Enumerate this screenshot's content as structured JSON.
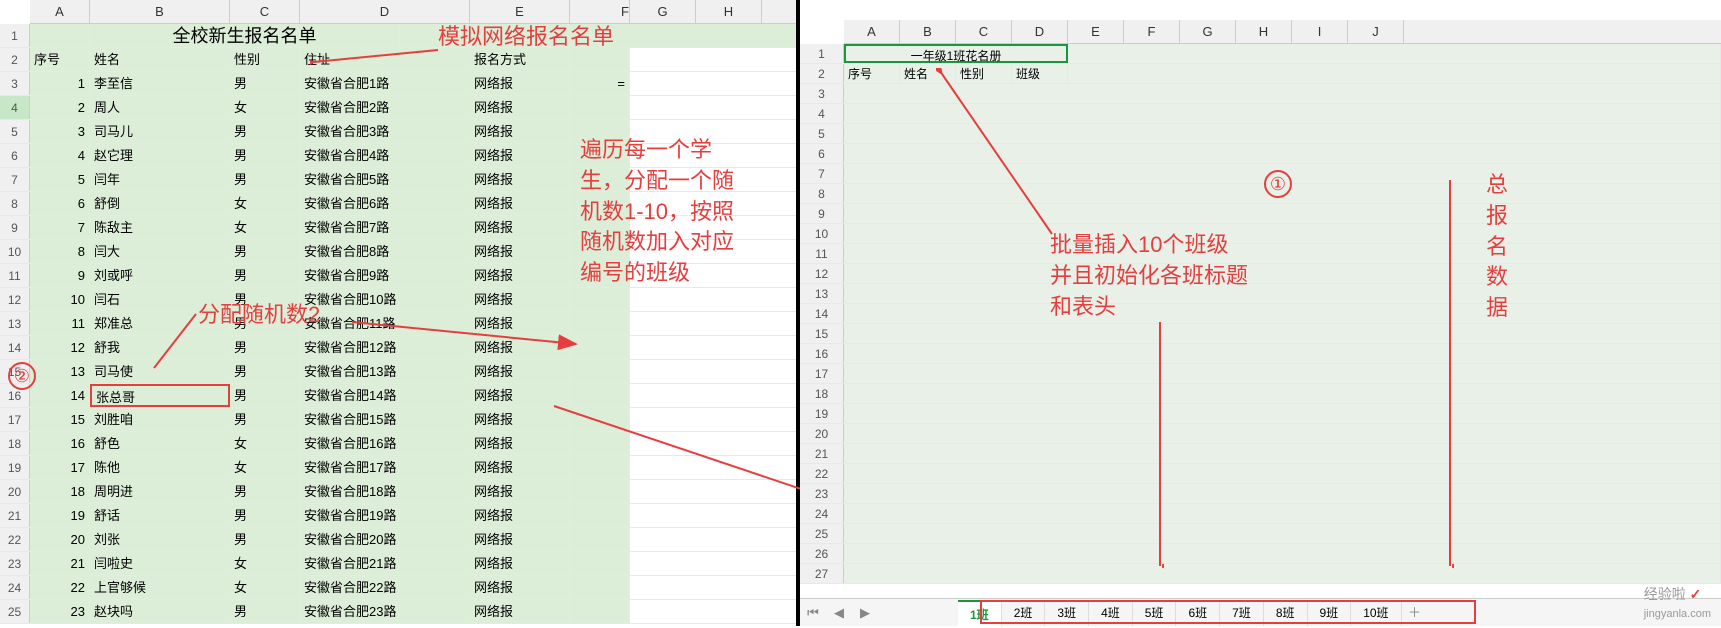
{
  "left": {
    "title": "全校新生报名名单",
    "cols": [
      "A",
      "B",
      "C",
      "D",
      "E",
      "F",
      "G",
      "H"
    ],
    "headers": [
      "序号",
      "姓名",
      "性别",
      "住址",
      "报名方式"
    ],
    "rows": [
      {
        "n": 1,
        "name": "李至信",
        "sex": "男",
        "addr": "安徽省合肥1路",
        "way": "网络报"
      },
      {
        "n": 2,
        "name": "周人",
        "sex": "女",
        "addr": "安徽省合肥2路",
        "way": "网络报"
      },
      {
        "n": 3,
        "name": "司马儿",
        "sex": "男",
        "addr": "安徽省合肥3路",
        "way": "网络报"
      },
      {
        "n": 4,
        "name": "赵它理",
        "sex": "男",
        "addr": "安徽省合肥4路",
        "way": "网络报"
      },
      {
        "n": 5,
        "name": "闫年",
        "sex": "男",
        "addr": "安徽省合肥5路",
        "way": "网络报"
      },
      {
        "n": 6,
        "name": "舒倒",
        "sex": "女",
        "addr": "安徽省合肥6路",
        "way": "网络报"
      },
      {
        "n": 7,
        "name": "陈敌主",
        "sex": "女",
        "addr": "安徽省合肥7路",
        "way": "网络报"
      },
      {
        "n": 8,
        "name": "闫大",
        "sex": "男",
        "addr": "安徽省合肥8路",
        "way": "网络报"
      },
      {
        "n": 9,
        "name": "刘或呼",
        "sex": "男",
        "addr": "安徽省合肥9路",
        "way": "网络报"
      },
      {
        "n": 10,
        "name": "闫石",
        "sex": "男",
        "addr": "安徽省合肥10路",
        "way": "网络报"
      },
      {
        "n": 11,
        "name": "郑准总",
        "sex": "男",
        "addr": "安徽省合肥11路",
        "way": "网络报"
      },
      {
        "n": 12,
        "name": "舒我",
        "sex": "男",
        "addr": "安徽省合肥12路",
        "way": "网络报"
      },
      {
        "n": 13,
        "name": "司马使",
        "sex": "男",
        "addr": "安徽省合肥13路",
        "way": "网络报"
      },
      {
        "n": 14,
        "name": "张总哥",
        "sex": "男",
        "addr": "安徽省合肥14路",
        "way": "网络报"
      },
      {
        "n": 15,
        "name": "刘胜咱",
        "sex": "男",
        "addr": "安徽省合肥15路",
        "way": "网络报"
      },
      {
        "n": 16,
        "name": "舒色",
        "sex": "女",
        "addr": "安徽省合肥16路",
        "way": "网络报"
      },
      {
        "n": 17,
        "name": "陈他",
        "sex": "女",
        "addr": "安徽省合肥17路",
        "way": "网络报"
      },
      {
        "n": 18,
        "name": "周明进",
        "sex": "男",
        "addr": "安徽省合肥18路",
        "way": "网络报"
      },
      {
        "n": 19,
        "name": "舒话",
        "sex": "男",
        "addr": "安徽省合肥19路",
        "way": "网络报"
      },
      {
        "n": 20,
        "name": "刘张",
        "sex": "男",
        "addr": "安徽省合肥20路",
        "way": "网络报"
      },
      {
        "n": 21,
        "name": "闫啦史",
        "sex": "女",
        "addr": "安徽省合肥21路",
        "way": "网络报"
      },
      {
        "n": 22,
        "name": "上官够候",
        "sex": "女",
        "addr": "安徽省合肥22路",
        "way": "网络报"
      },
      {
        "n": 23,
        "name": "赵块吗",
        "sex": "男",
        "addr": "安徽省合肥23路",
        "way": "网络报"
      }
    ],
    "annotations": {
      "topnote": "模拟网络报名名单",
      "midnote": "分配随机数2",
      "rightnote": "遍历每一个学生，分配一个随机数1-10，按照随机数加入对应编号的班级",
      "circle": "②"
    }
  },
  "right": {
    "cols": [
      "A",
      "B",
      "C",
      "D",
      "E",
      "F",
      "G",
      "H",
      "I",
      "J"
    ],
    "title": "一年级1班花名册",
    "headers": [
      "序号",
      "姓名",
      "性别",
      "班级"
    ],
    "rownums": [
      1,
      2,
      3,
      4,
      5,
      6,
      7,
      8,
      9,
      10,
      11,
      12,
      13,
      14,
      15,
      16,
      17,
      18,
      19,
      20,
      21,
      22,
      23,
      24,
      25,
      26,
      27
    ],
    "annotations": {
      "circle": "①",
      "note1": "批量插入10个班级\n并且初始化各班标题\n和表头",
      "vnote": "总报名数据"
    },
    "tabs": [
      "1班",
      "2班",
      "3班",
      "4班",
      "5班",
      "6班",
      "7班",
      "8班",
      "9班",
      "10班"
    ],
    "active_tab": 0
  },
  "watermark": {
    "label": "经验啦",
    "check": "✓",
    "url": "jingyanla.com"
  }
}
